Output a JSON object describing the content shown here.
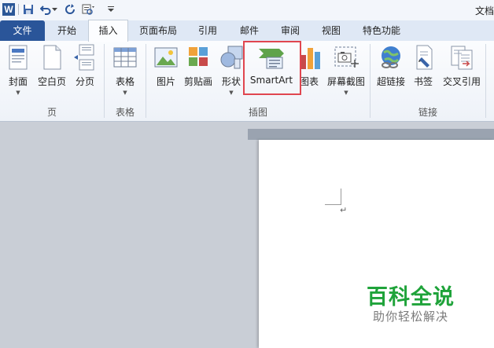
{
  "window": {
    "title_partial": "文档"
  },
  "quick_access": {
    "app_icon_letter": "W"
  },
  "tabs": [
    {
      "label": "文件",
      "active": false
    },
    {
      "label": "开始",
      "active": false
    },
    {
      "label": "插入",
      "active": true
    },
    {
      "label": "页面布局",
      "active": false
    },
    {
      "label": "引用",
      "active": false
    },
    {
      "label": "邮件",
      "active": false
    },
    {
      "label": "审阅",
      "active": false
    },
    {
      "label": "视图",
      "active": false
    },
    {
      "label": "特色功能",
      "active": false
    }
  ],
  "ribbon": {
    "groups": {
      "pages": "页",
      "tables": "表格",
      "illustrations": "插图",
      "links": "链接"
    },
    "buttons": {
      "cover": "封面",
      "blank_page": "空白页",
      "page_break": "分页",
      "table": "表格",
      "picture": "图片",
      "clipart": "剪贴画",
      "shapes": "形状",
      "smartart": "SmartArt",
      "chart": "图表",
      "screenshot": "屏幕截图",
      "hyperlink": "超链接",
      "bookmark": "书签",
      "cross_reference": "交叉引用"
    }
  },
  "document": {
    "paragraph_mark": "↵"
  },
  "watermark": {
    "title": "百科全说",
    "subtitle": "助你轻松解决"
  },
  "colors": {
    "file_tab": "#2a5599",
    "highlight": "#e0464f",
    "watermark": "#1fa33a"
  }
}
